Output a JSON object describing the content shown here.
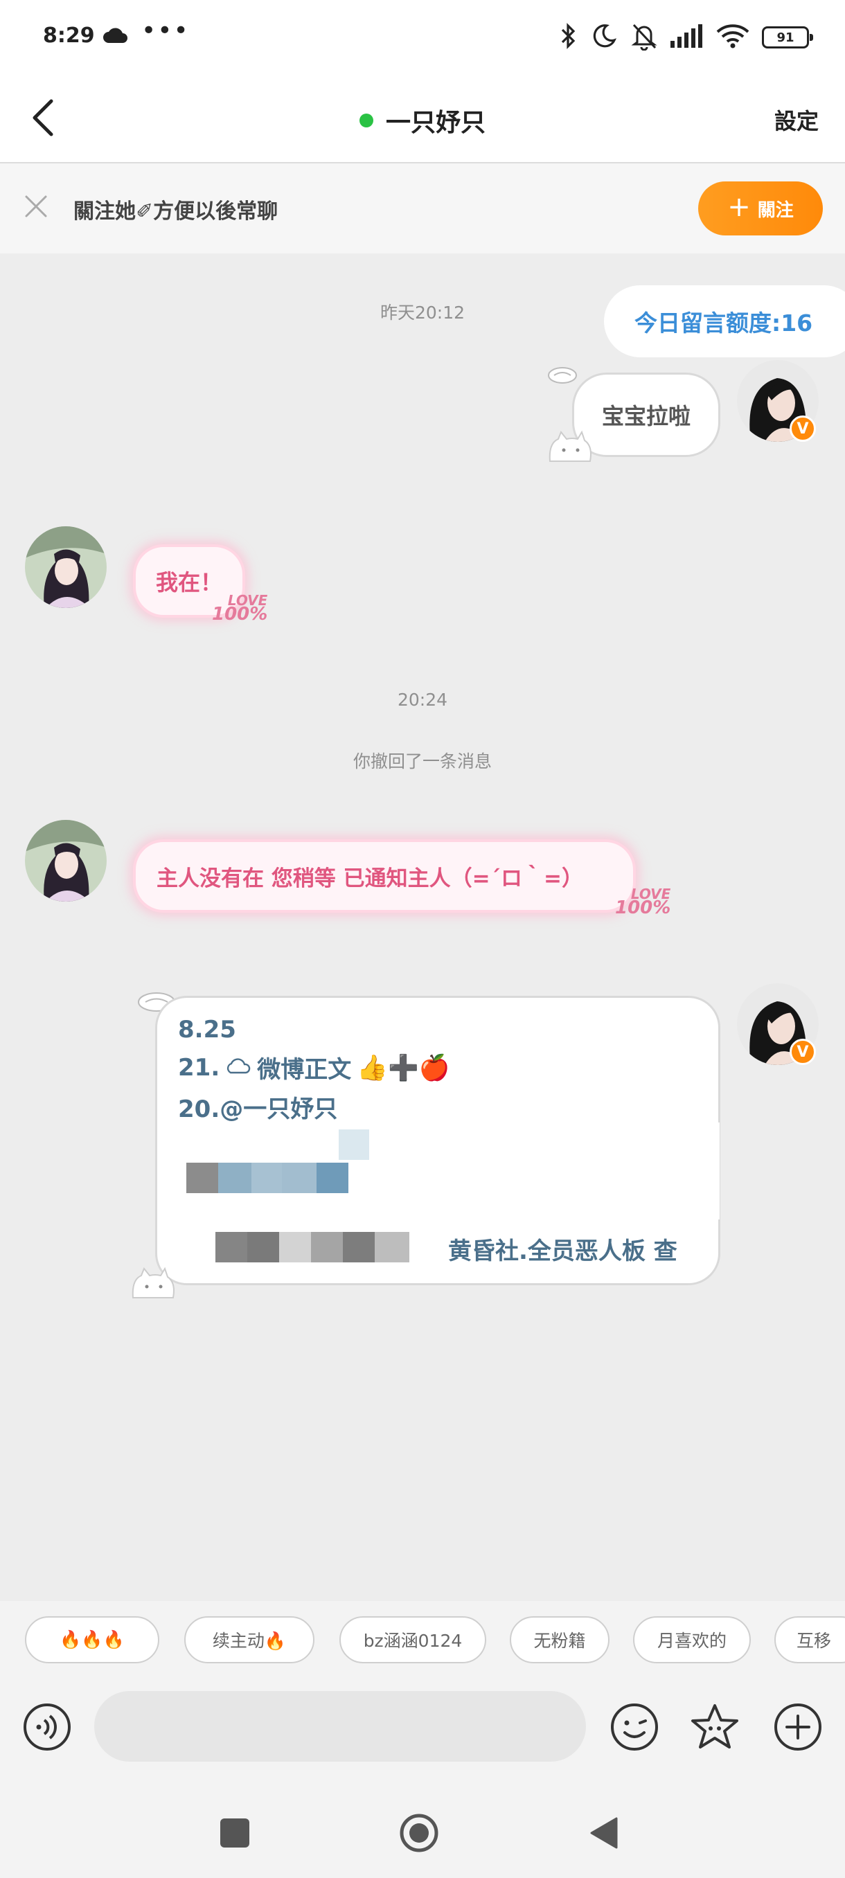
{
  "status_bar": {
    "time": "8:29",
    "more": "•••",
    "battery": "91",
    "icons": [
      "cloud-icon",
      "bluetooth-icon",
      "moon-icon",
      "bell-off-icon",
      "signal-icon",
      "wifi-icon",
      "battery-icon"
    ]
  },
  "header": {
    "title": "一只妤只",
    "online": true,
    "settings_label": "設定"
  },
  "follow_banner": {
    "text": "關注她✐方便以後常聊",
    "follow_label": "關注",
    "follow_plus": "+"
  },
  "chat": {
    "timestamp_1": "昨天20:12",
    "quota": "今日留言额度:16",
    "messages": [
      {
        "side": "right",
        "text": "宝宝拉啦"
      },
      {
        "side": "left",
        "text": "我在！",
        "tag": "LOVE",
        "tag_num": "100%"
      },
      {
        "side": "left",
        "text": "主人没有在 您稍等 已通知主人（=´ロ｀=）",
        "tag": "LOVE",
        "tag_num": "100%"
      }
    ],
    "timestamp_2": "20:24",
    "recall_notice": "你撤回了一条消息",
    "last_message": {
      "line_1": "8.25",
      "line_2": "21.",
      "line_2_text": "微博正文",
      "line_2_emoji": "👍➕🍎",
      "line_3": "20.@一只妤只",
      "line_4": "黄昏社.全员恶人板 查"
    }
  },
  "quick_replies": [
    "🔥🔥🔥",
    "续主动🔥",
    "bz涵涵0124",
    "无粉籍",
    "月喜欢的",
    "互移"
  ],
  "input": {
    "placeholder": ""
  },
  "colors": {
    "accent": "#ff8a0a",
    "link_blue": "#3b8ed8",
    "online": "#2ac244",
    "pink_text": "#e0567f"
  }
}
